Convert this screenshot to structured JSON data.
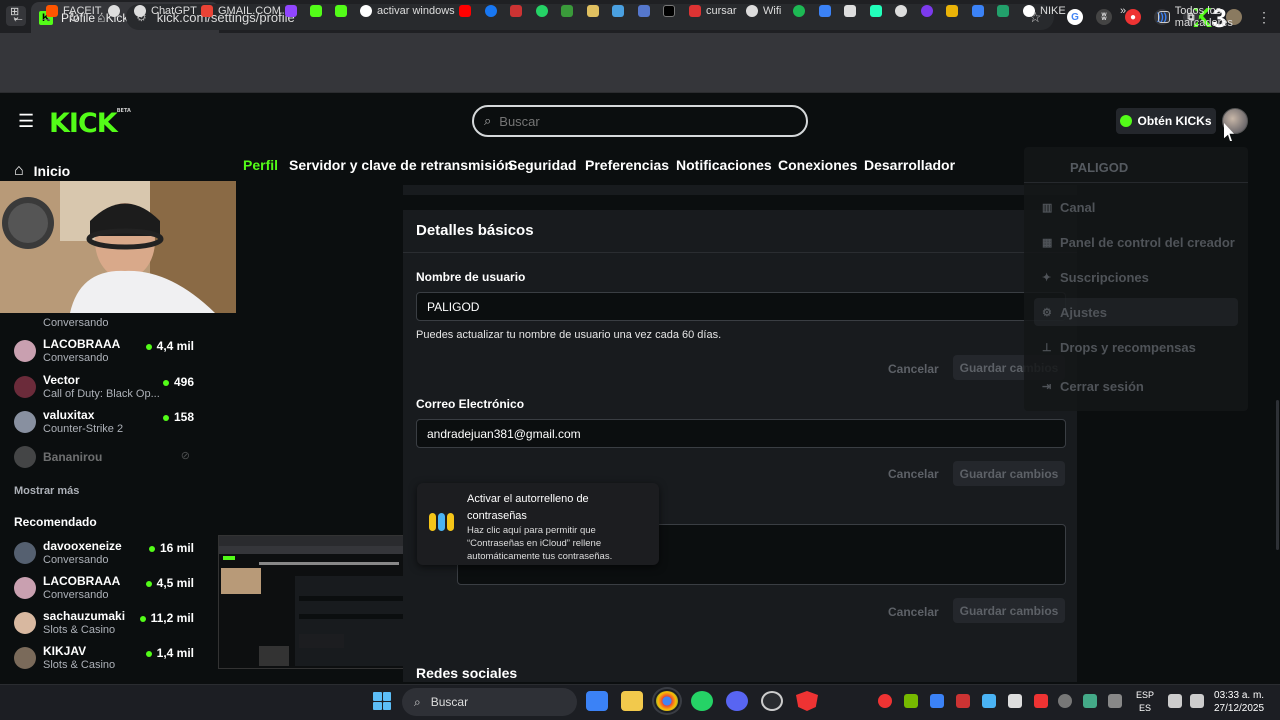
{
  "browser": {
    "tab_title": "Profile - Kick Streaming",
    "url": "kick.com/settings/profile",
    "bookmarks": [
      "FACEIT.",
      "ChatGPT",
      "GMAIL.COM",
      "activar windows",
      "cursar",
      "Wifi",
      "NIKE"
    ],
    "all_bookmarks": "Todos los marcadores"
  },
  "header": {
    "logo": "KICK",
    "logo_beta": "BETA",
    "search_placeholder": "Buscar",
    "kicks_button": "Obtén KICKs"
  },
  "sidebar": {
    "home": "Inicio",
    "following": [
      {
        "name": "",
        "sub": "Conversando",
        "viewers": ""
      },
      {
        "name": "LACOBRAAA",
        "sub": "Conversando",
        "viewers": "4,4 mil"
      },
      {
        "name": "Vector",
        "sub": "Call of Duty: Black Op...",
        "viewers": "496"
      },
      {
        "name": "valuxitax",
        "sub": "Counter-Strike 2",
        "viewers": "158"
      },
      {
        "name": "Bananirou",
        "sub": "",
        "viewers": ""
      }
    ],
    "show_more": "Mostrar más",
    "recommended_title": "Recomendado",
    "recommended": [
      {
        "name": "davooxeneize",
        "sub": "Conversando",
        "viewers": "16 mil"
      },
      {
        "name": "LACOBRAAA",
        "sub": "Conversando",
        "viewers": "4,5 mil"
      },
      {
        "name": "sachauzumaki",
        "sub": "Slots & Casino",
        "viewers": "11,2 mil"
      },
      {
        "name": "KIKJAV",
        "sub": "Slots & Casino",
        "viewers": "1,4 mil"
      }
    ]
  },
  "settings_tabs": [
    "Perfil",
    "Servidor y clave de retransmisión",
    "Seguridad",
    "Preferencias",
    "Notificaciones",
    "Conexiones",
    "Desarrollador"
  ],
  "profile": {
    "section_title": "Detalles básicos",
    "username_label": "Nombre de usuario",
    "username_value": "PALIGOD",
    "username_help": "Puedes actualizar tu nombre de usuario una vez cada 60 días.",
    "email_label": "Correo Electrónico",
    "email_value": "andradejuan381@gmail.com",
    "cancel": "Cancelar",
    "save": "Guardar cambios",
    "social_title": "Redes sociales"
  },
  "tooltip": {
    "title": "Activar el autorrelleno de contraseñas",
    "body": "Haz clic aquí para permitir que “Contraseñas en iCloud” rellene automáticamente tus contraseñas."
  },
  "dropdown": {
    "username": "PALIGOD",
    "items": [
      "Canal",
      "Panel de control del creador",
      "Suscripciones",
      "Ajustes",
      "Drops y recompensas",
      "Cerrar sesión"
    ]
  },
  "taskbar": {
    "search": "Buscar",
    "lang1": "ESP",
    "lang2": "ES",
    "time": "03:33 a. m.",
    "date": "27/12/2025"
  },
  "colors": {
    "accent": "#53fc18",
    "bg": "#0b0e0f",
    "panel": "#181b1e"
  }
}
